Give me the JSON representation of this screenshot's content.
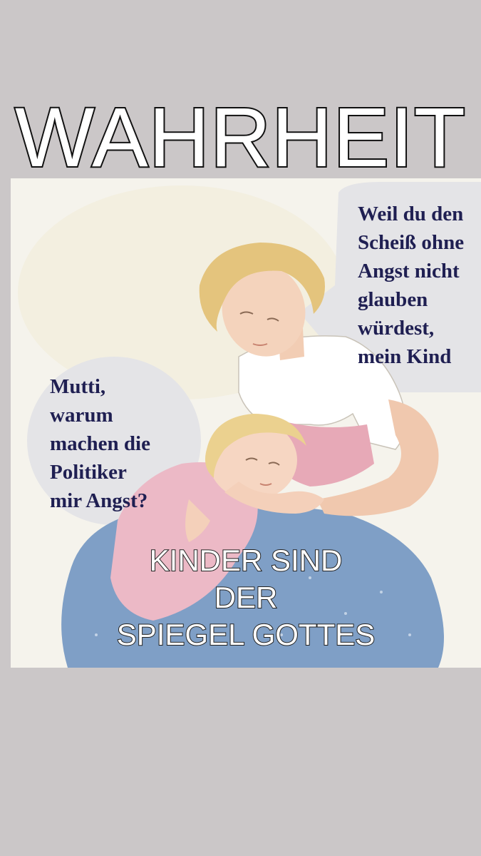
{
  "headline": "WAHRHEIT",
  "mother_bubble": {
    "lines": [
      "Weil du den",
      "Scheiß ohne",
      "Angst nicht",
      "glauben",
      "würdest,",
      "mein Kind"
    ]
  },
  "child_bubble": {
    "lines": [
      "Mutti,",
      "warum",
      "machen die",
      "Politiker",
      "mir Angst?"
    ]
  },
  "caption": {
    "lines": [
      "KINDER SIND",
      "DER",
      "SPIEGEL GOTTES"
    ]
  },
  "colors": {
    "background": "#cbc7c8",
    "bubble_text": "#1f1f52",
    "bubble_fill": "#e3e3e6"
  }
}
